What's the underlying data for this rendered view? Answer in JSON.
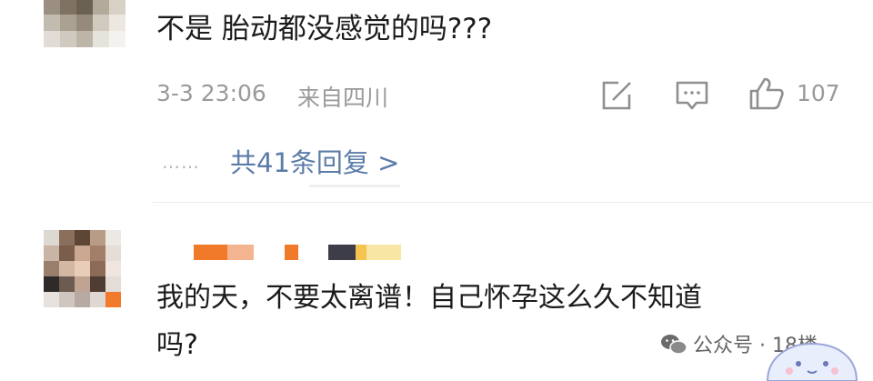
{
  "comment1": {
    "text": "不是 胎动都没感觉的吗???",
    "date": "3-3 23:06",
    "location": "来自四川",
    "like_count": "107",
    "replies_link": "共41条回复 >",
    "icons": {
      "share": "share-icon",
      "comment": "comment-icon",
      "like": "like-icon"
    }
  },
  "comment2": {
    "line1": "我的天，不要太离谱！自己怀孕这么久不知道",
    "line2": "吗?"
  },
  "watermark": {
    "text": "公众号 · 18楼",
    "icon": "wechat-icon"
  },
  "colors": {
    "text": "#1b1b1b",
    "meta": "#9a9a9a",
    "link": "#5b7ca8",
    "name_orange": "#f07a2a",
    "name_peach": "#f3b48f",
    "name_dark": "#3d3d4a",
    "name_yellow": "#f5dc7c"
  }
}
